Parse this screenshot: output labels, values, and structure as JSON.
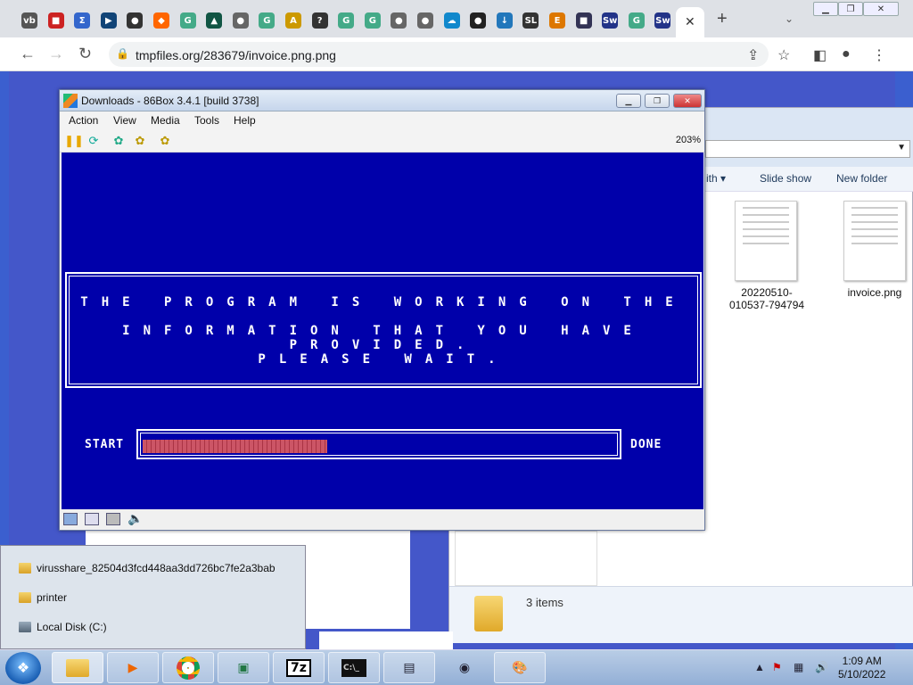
{
  "browser": {
    "url": "tmpfiles.org/283679/invoice.png.png",
    "tab_icons": [
      "vb",
      "■",
      "Σ",
      "▶",
      "●",
      "◆",
      "G",
      "▲",
      "●",
      "G",
      "A",
      "?",
      "G",
      "G",
      "●",
      "●",
      "☁",
      "●",
      "↓",
      "SL",
      "E",
      "■",
      "Sw",
      "G",
      "Sw"
    ],
    "tab_close": "✕",
    "new_tab": "+",
    "tab_search": "⌄"
  },
  "box86": {
    "title": "Downloads - 86Box 3.4.1 [build 3738]",
    "menu": [
      "Action",
      "View",
      "Media",
      "Tools",
      "Help"
    ],
    "zoom": "203%",
    "dos_line1": "THE PROGRAM IS WORKING ON THE",
    "dos_line2": "INFORMATION THAT YOU HAVE PROVIDED.",
    "dos_line3": "PLEASE WAIT.",
    "start_label": "START",
    "done_label": "DONE",
    "progress": 0.39,
    "bg_color": "#0000aa",
    "bar_color": "#cc5566"
  },
  "explorer": {
    "cmd_with": "ith ▾",
    "slideshow": "Slide show",
    "new_folder": "New folder",
    "file1_name": "20220510-010537-794794",
    "file2_name": "invoice.png",
    "item_count": "3 items"
  },
  "jumplist": {
    "items": [
      "virusshare_82504d3fcd448aa3dd726bc7fe2a3bab",
      "printer",
      "Local Disk (C:)"
    ]
  },
  "taskbar": {
    "time": "1:09 AM",
    "date": "5/10/2022",
    "app_7z": "7z"
  }
}
